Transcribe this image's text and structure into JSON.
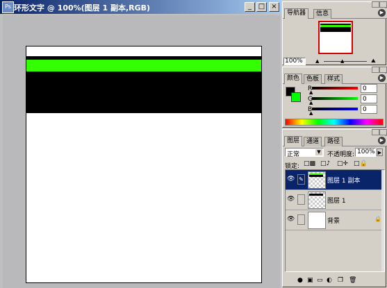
{
  "document": {
    "title": "环形文字 @ 100%(图层 1 副本,RGB)",
    "controls": [
      "_",
      "□",
      "×"
    ]
  },
  "canvas_colors": {
    "stripe_green": "#33ff00",
    "block_black": "#000000",
    "background": "#ffffff"
  },
  "navigator": {
    "tabs": [
      "导航器",
      "信息"
    ],
    "zoom": "100%"
  },
  "color_panel": {
    "tabs": [
      "颜色",
      "色板",
      "样式"
    ],
    "channels": [
      {
        "label": "R",
        "value": "0"
      },
      {
        "label": "G",
        "value": "0"
      },
      {
        "label": "B",
        "value": "0"
      }
    ],
    "foreground": "#000000",
    "background": "#00ff00"
  },
  "layers_panel": {
    "tabs": [
      "图层",
      "通道",
      "路径"
    ],
    "blend_mode": "正常",
    "opacity_label": "不透明度:",
    "opacity_value": "100%",
    "lock_label": "锁定:",
    "layers": [
      {
        "name": "图层 1 副本",
        "selected": true
      },
      {
        "name": "图层 1",
        "selected": false
      },
      {
        "name": "背景",
        "selected": false
      }
    ]
  }
}
